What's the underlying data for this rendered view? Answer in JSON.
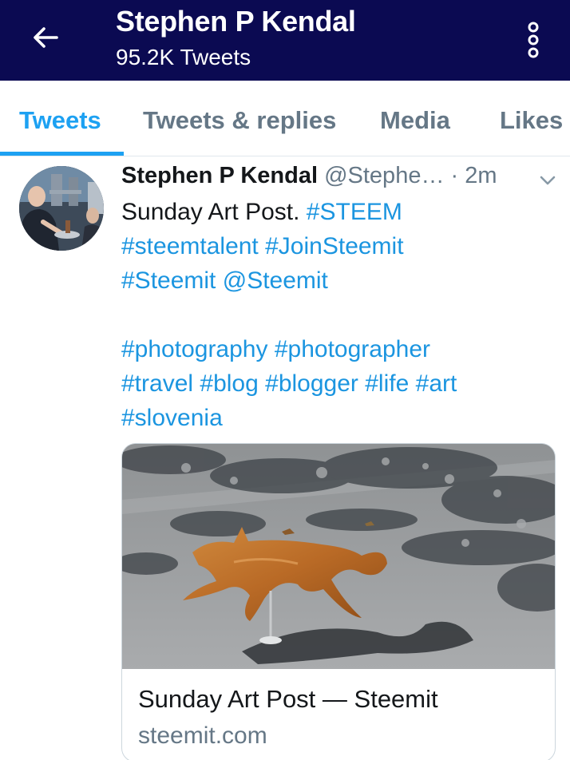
{
  "header": {
    "title": "Stephen P Kendal",
    "subtitle": "95.2K Tweets",
    "back_icon": "arrow-left-icon",
    "more_icon": "more-vertical-icon",
    "background": "#0b0a52"
  },
  "tabs": [
    {
      "label": "Tweets",
      "active": true
    },
    {
      "label": "Tweets & replies",
      "active": false
    },
    {
      "label": "Media",
      "active": false
    },
    {
      "label": "Likes",
      "active": false
    }
  ],
  "accent": "#1da1f2",
  "tweet": {
    "name": "Stephen P Kendal",
    "handle": "@Stephe…",
    "separator": "·",
    "time": "2m",
    "caret_icon": "chevron-down-icon",
    "text_lines": [
      {
        "plain": "Sunday Art Post. ",
        "links": [
          "#STEEM"
        ]
      },
      {
        "plain": "",
        "links": [
          "#steemtalent",
          "#JoinSteemit"
        ]
      },
      {
        "plain": "",
        "links": [
          "#Steemit",
          "@Steemit"
        ]
      },
      {
        "plain": "",
        "links": [
          "#photography",
          "#photographer"
        ]
      },
      {
        "plain": "",
        "links": [
          "#travel",
          "#blog",
          "#blogger",
          "#life",
          "#art"
        ]
      },
      {
        "plain": "",
        "links": [
          "#slovenia"
        ]
      }
    ],
    "card": {
      "title": "Sunday Art Post — Steemit",
      "domain": "steemit.com",
      "image": "wooden-fox-sculpture-on-pavement"
    }
  }
}
